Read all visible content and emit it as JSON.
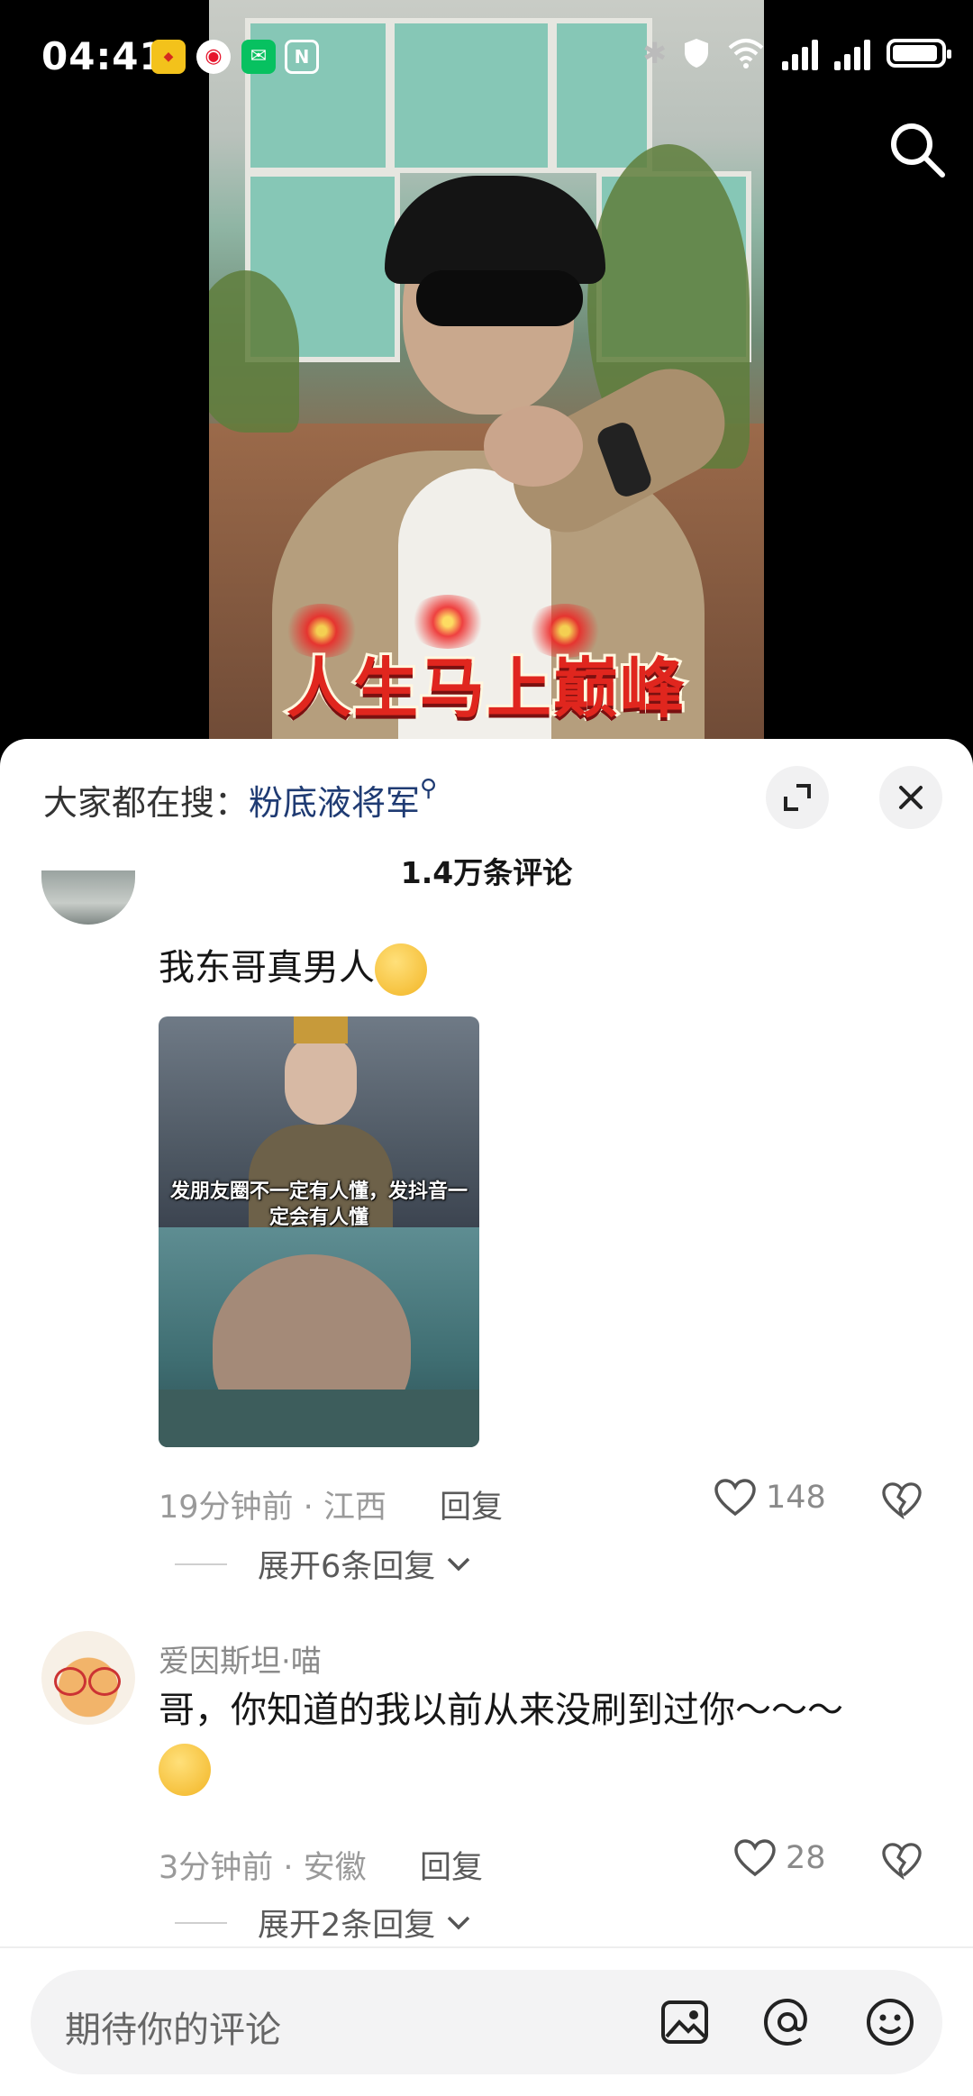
{
  "status_bar": {
    "time": "04:41",
    "notification_icons": [
      "game-app-icon",
      "weibo-icon",
      "wechat-icon",
      "nfc-icon"
    ],
    "system_icons": [
      "bluetooth-icon",
      "vpn-shield-icon",
      "wifi-icon",
      "signal-icon",
      "signal-icon",
      "battery-icon"
    ]
  },
  "video": {
    "caption": "人生马上巅峰"
  },
  "sheet": {
    "hot_search_prefix": "大家都在搜：",
    "hot_search_keyword": "粉底液将军",
    "comment_count": "1.4万条评论"
  },
  "comments": [
    {
      "text": "我东哥真男人",
      "image_caption": "发朋友圈不一定有人懂，发抖音一定会有人懂",
      "time": "19分钟前",
      "location": "江西",
      "reply_label": "回复",
      "likes": "148",
      "expand_label": "展开6条回复"
    },
    {
      "username": "爱因斯坦·喵",
      "text": "哥，你知道的我以前从来没刷到过你～～～",
      "time": "3分钟前",
      "location": "安徽",
      "reply_label": "回复",
      "likes": "28",
      "expand_label": "展开2条回复"
    }
  ],
  "input": {
    "placeholder": "期待你的评论"
  },
  "colors": {
    "keyword": "#1f3b73",
    "caption_red": "#e0261e",
    "sheet_bg": "#ffffff"
  }
}
